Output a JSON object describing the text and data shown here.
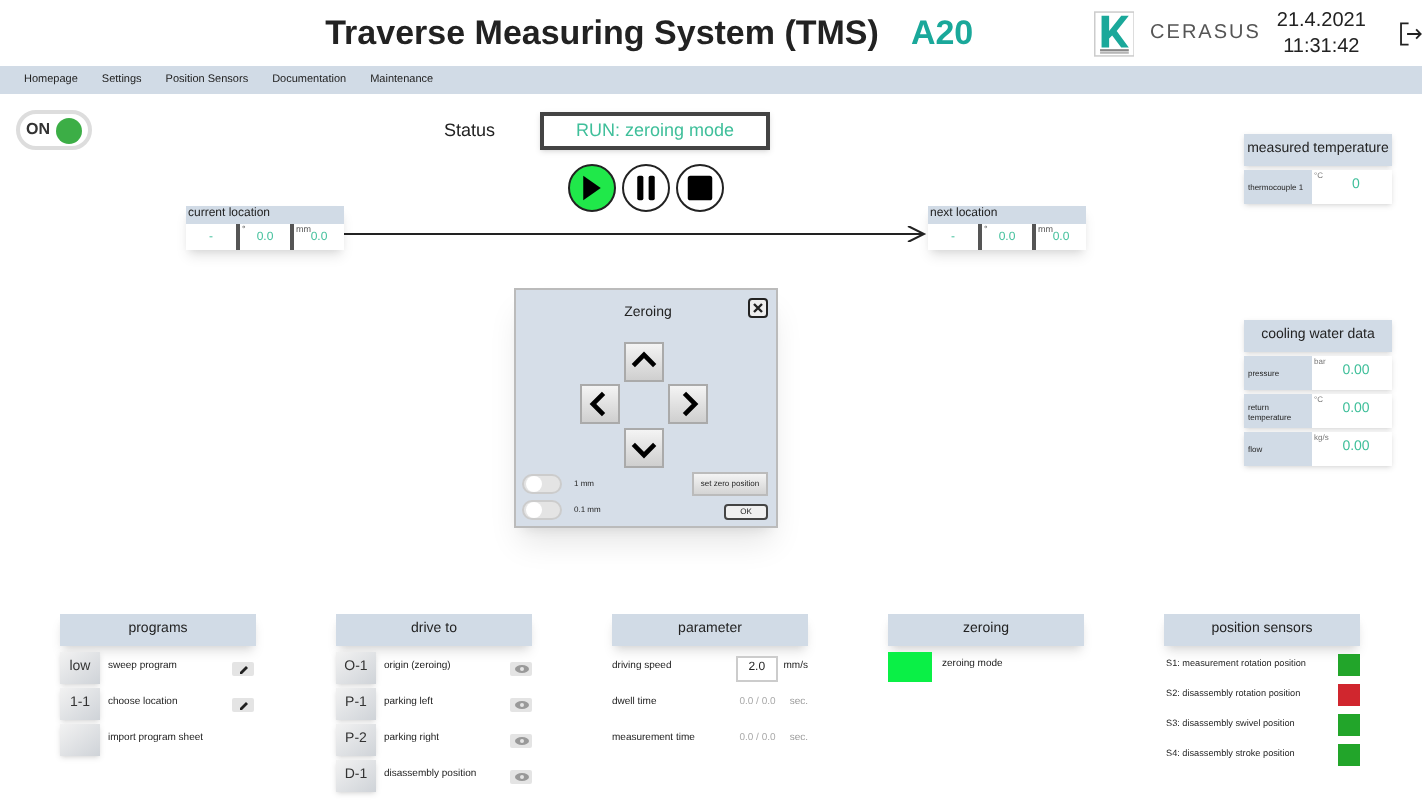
{
  "header": {
    "title": "Traverse Measuring System (TMS)",
    "unit": "A20",
    "brand": "CERASUS",
    "date": "21.4.2021",
    "time": "11:31:42"
  },
  "nav": [
    {
      "label": "Homepage"
    },
    {
      "label": "Settings"
    },
    {
      "label": "Position Sensors"
    },
    {
      "label": "Documentation"
    },
    {
      "label": "Maintenance"
    }
  ],
  "power": {
    "label": "ON",
    "on": true
  },
  "status": {
    "label": "Status",
    "value": "RUN: zeroing mode"
  },
  "run_controls": [
    {
      "kind": "play",
      "selected": true
    },
    {
      "kind": "pause",
      "selected": false
    },
    {
      "kind": "stop",
      "selected": false
    }
  ],
  "current_location": {
    "title": "current location",
    "cells": [
      {
        "value": "-"
      },
      {
        "unit": "°",
        "value": "0.0"
      },
      {
        "unit": "mm",
        "value": "0.0"
      }
    ]
  },
  "next_location": {
    "title": "next location",
    "cells": [
      {
        "value": "-"
      },
      {
        "unit": "°",
        "value": "0.0"
      },
      {
        "unit": "mm",
        "value": "0.0"
      }
    ]
  },
  "measured_temperature": {
    "title": "measured temperature",
    "rows": [
      {
        "label": "thermocouple 1",
        "unit": "°C",
        "value": "0"
      }
    ]
  },
  "cooling_water": {
    "title": "cooling water data",
    "rows": [
      {
        "label": "pressure",
        "unit": "bar",
        "value": "0.00"
      },
      {
        "label": "return temperature",
        "unit": "°C",
        "value": "0.00"
      },
      {
        "label": "flow",
        "unit": "kg/s",
        "value": "0.00"
      }
    ]
  },
  "zeroing_dialog": {
    "title": "Zeroing",
    "steps": [
      {
        "label": "1 mm",
        "on": false
      },
      {
        "label": "0.1 mm",
        "on": false
      }
    ],
    "set_zero": "set zero position",
    "ok": "OK"
  },
  "programs": {
    "title": "programs",
    "rows": [
      {
        "code": "low",
        "label": "sweep program",
        "editable": true
      },
      {
        "code": "1-1",
        "label": "choose location",
        "editable": true
      },
      {
        "label": "import program sheet",
        "editable": false
      }
    ]
  },
  "drive_to": {
    "title": "drive to",
    "rows": [
      {
        "code": "O-1",
        "label": "origin (zeroing)"
      },
      {
        "code": "P-1",
        "label": "parking left"
      },
      {
        "code": "P-2",
        "label": "parking right"
      },
      {
        "code": "D-1",
        "label": "disassembly position"
      }
    ]
  },
  "parameter": {
    "title": "parameter",
    "rows": [
      {
        "kind": "input",
        "label": "driving speed",
        "value": "2.0",
        "unit": "mm/s"
      },
      {
        "kind": "readout",
        "label": "dwell time",
        "value": "0.0 / 0.0",
        "unit": "sec."
      },
      {
        "kind": "readout",
        "label": "measurement time",
        "value": "0.0 / 0.0",
        "unit": "sec."
      }
    ]
  },
  "zeroing": {
    "title": "zeroing",
    "rows": [
      {
        "label": "zeroing mode",
        "on": true
      }
    ]
  },
  "position_sensors": {
    "title": "position sensors",
    "rows": [
      {
        "label": "S1: measurement rotation position",
        "color": "#22a52a"
      },
      {
        "label": "S2: disassembly rotation position",
        "color": "#d0262e"
      },
      {
        "label": "S3: disassembly swivel position",
        "color": "#22a52a"
      },
      {
        "label": "S4: disassembly stroke position",
        "color": "#22a52a"
      }
    ]
  }
}
